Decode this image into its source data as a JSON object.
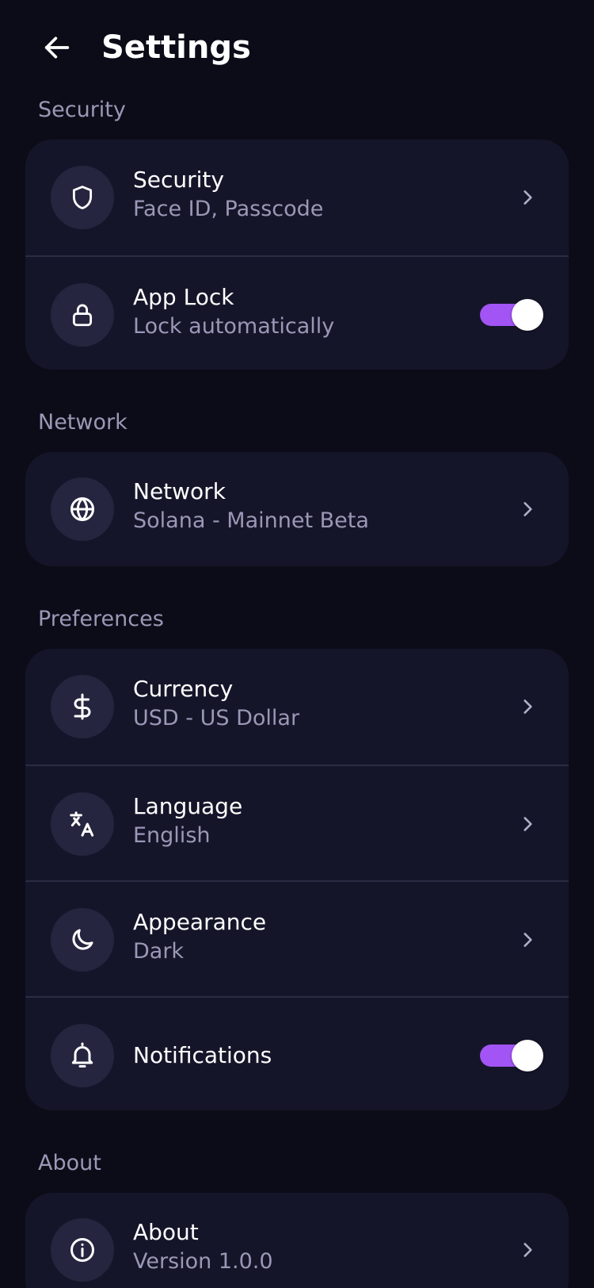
{
  "header": {
    "title": "Settings",
    "back_icon": "arrow-left-icon"
  },
  "colors": {
    "background": "#0c0c18",
    "card": "#15152a",
    "icon_circle": "#25253f",
    "accent": "#a254f4",
    "secondary_text": "#9a98b6",
    "divider": "#2b2b44"
  },
  "sections": {
    "security": {
      "label": "Security",
      "items": [
        {
          "title": "Security",
          "subtitle": "Face ID, Passcode",
          "icon": "shield-icon",
          "control": "chevron"
        },
        {
          "title": "App Lock",
          "subtitle": "Lock automatically",
          "icon": "lock-icon",
          "control": "toggle",
          "enabled": true
        }
      ]
    },
    "network": {
      "label": "Network",
      "items": [
        {
          "title": "Network",
          "subtitle": "Solana - Mainnet Beta",
          "icon": "globe-icon",
          "control": "chevron"
        }
      ]
    },
    "preferences": {
      "label": "Preferences",
      "items": [
        {
          "title": "Currency",
          "subtitle": "USD - US Dollar",
          "icon": "dollar-icon",
          "control": "chevron"
        },
        {
          "title": "Language",
          "subtitle": "English",
          "icon": "translate-icon",
          "control": "chevron"
        },
        {
          "title": "Appearance",
          "subtitle": "Dark",
          "icon": "moon-icon",
          "control": "chevron"
        },
        {
          "title": "Notifications",
          "icon": "bell-icon",
          "control": "toggle",
          "enabled": true
        }
      ]
    },
    "about": {
      "label": "About",
      "items": [
        {
          "title": "About",
          "subtitle": "Version 1.0.0",
          "icon": "info-icon",
          "control": "chevron"
        }
      ]
    }
  }
}
